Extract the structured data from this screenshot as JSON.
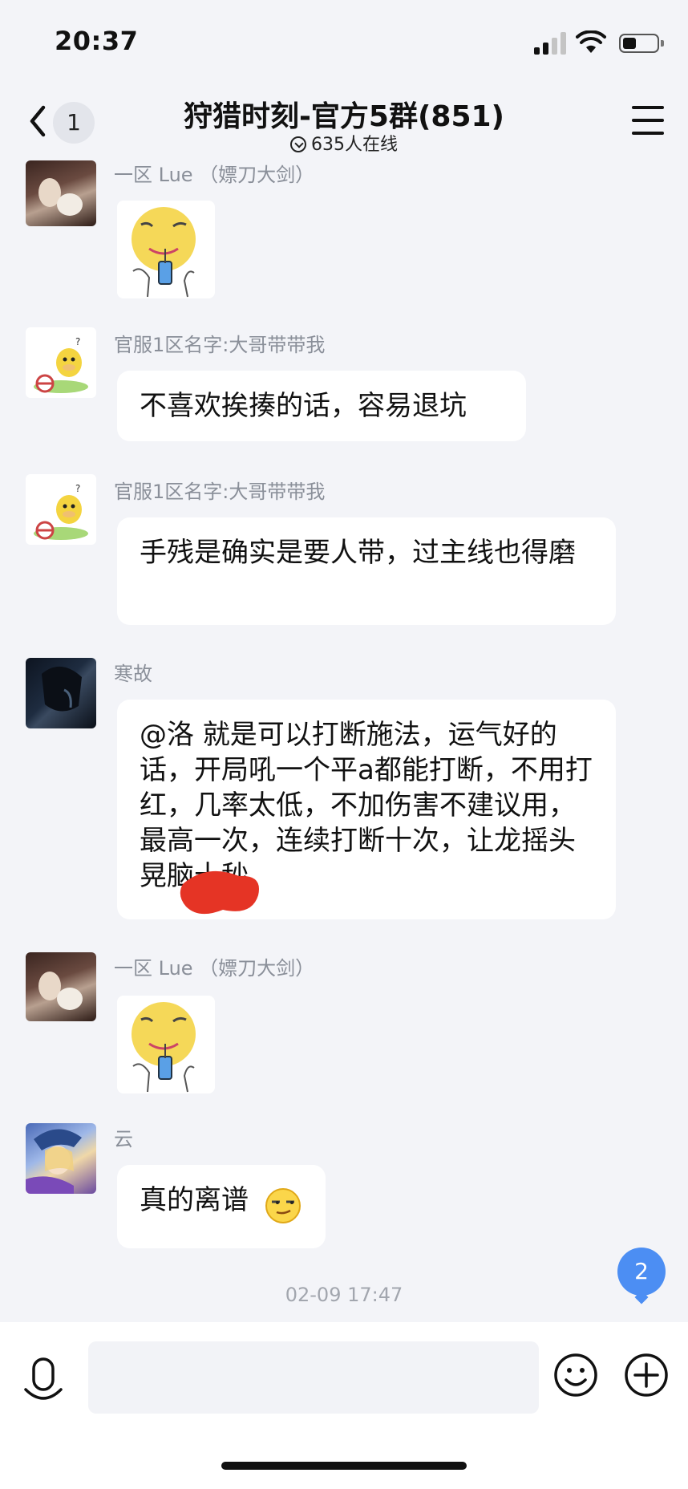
{
  "status_bar": {
    "time": "20:37"
  },
  "header": {
    "back_badge": "1",
    "title": "狩猎时刻-官方5群(851)",
    "online_text": "635人在线"
  },
  "messages": [
    {
      "sender": "一区 Lue （嫖刀大剑）",
      "type": "sticker",
      "avatar": "photo-avatar"
    },
    {
      "sender": "官服1区名字:大哥带带我",
      "type": "text",
      "text": "不喜欢挨揍的话，容易退坑",
      "avatar": "duck-avatar"
    },
    {
      "sender": "官服1区名字:大哥带带我",
      "type": "text",
      "text": "手残是确实是要人带，过主线也得磨",
      "avatar": "duck-avatar"
    },
    {
      "sender": "寒故",
      "type": "text",
      "text": "@洛 就是可以打断施法，运气好的话，开局吼一个平a都能打断，不用打红，几率太低，不加伤害不建议用，最高一次，连续打断十次，让龙摇头晃脑十秒",
      "avatar": "dark-avatar"
    },
    {
      "sender": "一区 Lue （嫖刀大剑）",
      "type": "sticker",
      "avatar": "photo-avatar"
    },
    {
      "sender": "云",
      "type": "text",
      "text": "真的离谱",
      "avatar": "anime-avatar"
    }
  ],
  "timestamp": "02-09 17:47",
  "new_message_count": "2",
  "input": {
    "placeholder": ""
  },
  "colors": {
    "background": "#f3f4f8",
    "bubble": "#ffffff",
    "accent_blue": "#4c8ef3",
    "sender_gray": "#8a8f99"
  }
}
